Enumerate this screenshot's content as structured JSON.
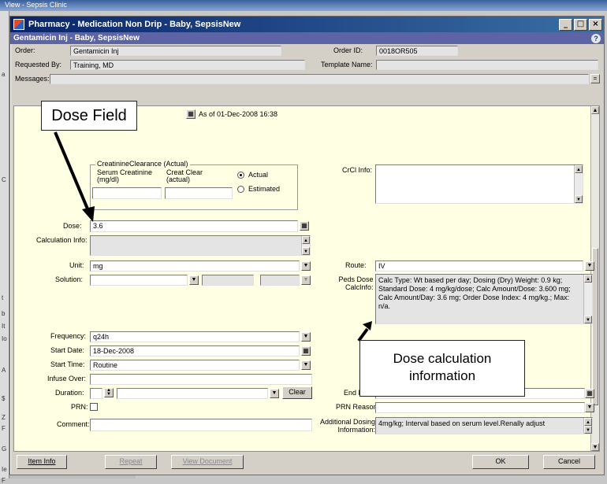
{
  "background": {
    "taskbar_text": "View - Sepsis Clinic",
    "side_letters": [
      "a",
      "C",
      "t",
      "b",
      "It",
      "Io",
      "A",
      "$",
      "Z",
      "F",
      "G",
      "Ie",
      "F"
    ]
  },
  "window": {
    "title": "Pharmacy - Medication Non Drip - Baby, SepsisNew",
    "subheader": "Gentamicin Inj - Baby, SepsisNew",
    "help_glyph": "?",
    "buttons": {
      "minimize": "_",
      "maximize": "□",
      "close": "×"
    }
  },
  "header": {
    "order_label": "Order:",
    "order_value": "Gentamicin Inj",
    "order_id_label": "Order ID:",
    "order_id_value": "0018OR505",
    "requested_by_label": "Requested By:",
    "requested_by_value": "Training, MD",
    "template_label": "Template Name:",
    "template_value": "",
    "messages_label": "Messages:",
    "messages_value": ""
  },
  "form": {
    "as_of": "As of 01-Dec-2008 16:38",
    "creatinine_group_title": "CreatinineClearance (Actual)",
    "serum_creatinine_label": "Serum Creatinine (mg/dl)",
    "creat_clear_label": "Creat Clear (actual)",
    "radio_actual": "Actual",
    "radio_estimated": "Estimated",
    "ccl_info_label": "CrCl Info:",
    "dose_label": "Dose:",
    "dose_value": "3.6",
    "calc_info_label": "Calculation Info:",
    "unit_label": "Unit:",
    "unit_value": "mg",
    "route_label": "Route:",
    "route_value": "IV",
    "solution_label": "Solution:",
    "peds_label_1": "Peds Dose",
    "peds_label_2": "CalcInfo:",
    "peds_text": "Calc Type: Wt based per day;    Dosing (Dry) Weight: 0.9 kg;   Standard Dose: 4 mg/kg/dose;   Calc Amount/Dose: 3.600 mg;   Calc Amount/Day: 3.6 mg;    Order Dose Index: 4 mg/kg.;    Max: n/a.",
    "frequency_label": "Frequency:",
    "frequency_value": "q24h",
    "start_date_label": "Start Date:",
    "start_date_value": "18-Dec-2008",
    "start_time_label": "Start Time:",
    "start_time_value": "Routine",
    "infuse_over_label": "Infuse Over:",
    "duration_label": "Duration:",
    "clear_label": "Clear",
    "end_date_label": "End Date:",
    "prn_label": "PRN:",
    "prn_reason_label": "PRN Reason:",
    "comment_label": "Comment:",
    "additional_label_1": "Additional Dosing",
    "additional_label_2": "Information:",
    "additional_value": "4mg/kg; Interval based on serum level.Renally adjust"
  },
  "footer": {
    "item_info": "Item Info",
    "repeat": "Repeat",
    "view_document": "View Document",
    "ok": "OK",
    "cancel": "Cancel"
  },
  "annotations": {
    "dose_field": "Dose Field",
    "dose_calc_line1": "Dose calculation",
    "dose_calc_line2": "information"
  },
  "colors": {
    "content_bg": "#ffffe4",
    "title_bar": "#0a246a",
    "subheader": "#5d64a6"
  }
}
